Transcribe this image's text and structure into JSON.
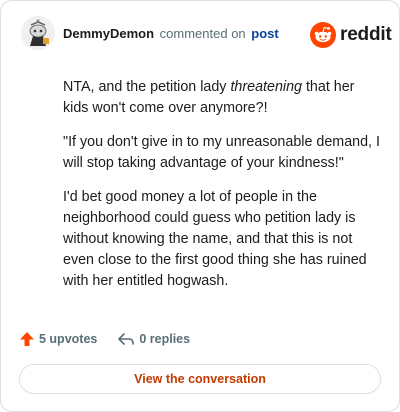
{
  "header": {
    "author": "DemmyDemon",
    "action": "commented on",
    "post_link": "post"
  },
  "brand": {
    "wordmark": "reddit",
    "accent_color": "#ff4500"
  },
  "comment": {
    "intro_before": "NTA, and the petition lady ",
    "intro_emphasis": "threatening",
    "intro_after": " that her kids won't come over anymore?!",
    "quote": "\"If you don't give in to my unreasonable demand, I will stop taking advantage of your kindness!\"",
    "closing": "I'd bet good money a lot of people in the neighborhood could guess who petition lady is without knowing the name, and that this is not even close to the first good thing she has ruined with her entitled hogwash."
  },
  "footer": {
    "upvotes": "5 upvotes",
    "replies": "0 replies",
    "upvote_icon": "upvote-arrow-icon",
    "reply_icon": "reply-arrow-icon"
  },
  "cta": {
    "label": "View the conversation"
  }
}
